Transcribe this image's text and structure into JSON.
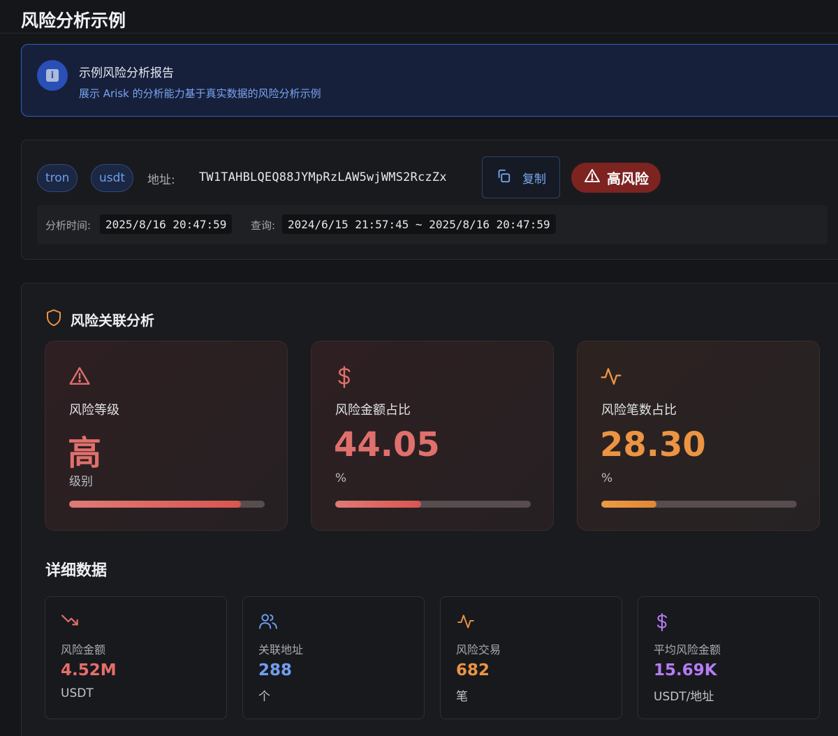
{
  "page": {
    "title": "风险分析示例"
  },
  "banner": {
    "title": "示例风险分析报告",
    "subtitle": "展示 Arisk 的分析能力基于真实数据的风险分析示例",
    "icon": "info-icon"
  },
  "address": {
    "chain_tag": "tron",
    "token_tag": "usdt",
    "label": "地址:",
    "value": "TW1TAHBLQEQ88JYMpRzLAW5wjWMS2RczZx",
    "copy_label": "复制",
    "risk_badge": "高风险",
    "analysis_time_label": "分析时间:",
    "analysis_time": "2025/8/16 20:47:59",
    "query_label": "查询:",
    "query_range": "2024/6/15 21:57:45 ~ 2025/8/16 20:47:59"
  },
  "analysis": {
    "title": "风险关联分析",
    "metrics": [
      {
        "icon": "alert-triangle-icon",
        "label": "风险等级",
        "value": "高",
        "unit": "级别",
        "progress": 0.88,
        "color": "#e0706c"
      },
      {
        "icon": "dollar-icon",
        "label": "风险金额占比",
        "value": "44.05",
        "unit": "%",
        "progress": 0.4405,
        "color": "#e0706c"
      },
      {
        "icon": "activity-icon",
        "label": "风险笔数占比",
        "value": "28.30",
        "unit": "%",
        "progress": 0.283,
        "color": "#ec9443"
      }
    ]
  },
  "details": {
    "title": "详细数据",
    "stats": [
      {
        "icon": "trending-down-icon",
        "label": "风险金额",
        "value": "4.52M",
        "unit": "USDT",
        "color": "#e56f69"
      },
      {
        "icon": "users-icon",
        "label": "关联地址",
        "value": "288",
        "unit": "个",
        "color": "#6f9ff0"
      },
      {
        "icon": "activity-icon",
        "label": "风险交易",
        "value": "682",
        "unit": "笔",
        "color": "#ec9443"
      },
      {
        "icon": "dollar-icon",
        "label": "平均风险金额",
        "value": "15.69K",
        "unit": "USDT/地址",
        "color": "#b57cf4"
      }
    ]
  },
  "colors": {
    "accent_blue": "#6e9ff0",
    "risk_red": "#7d2320",
    "warning_orange": "#ec9443",
    "purple": "#b57cf4"
  }
}
